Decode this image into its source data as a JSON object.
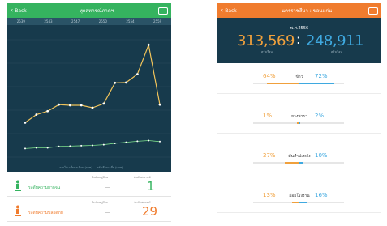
{
  "colors": {
    "green_nav": "#35b35f",
    "orange_nav": "#f07c2e",
    "dark_panel": "#173a4c",
    "orange_value": "#f0a03c",
    "blue_value": "#3fa9e0"
  },
  "left": {
    "nav": {
      "back_label": "Back",
      "title": "ทุกสหกรณ์ภาคฯ",
      "menu_icon": "menu-icon"
    },
    "years": [
      "2539",
      "2543",
      "2547",
      "2550",
      "2554",
      "2559"
    ],
    "legend": "— รายได้เฉลี่ยต่อเดือน (บาท) — ครัวเรือนเฉลี่ย (บาท)",
    "stats": {
      "rows": [
        {
          "name": "ระดับความยากจน",
          "col1_label": "อันดับหมู่บ้าน",
          "col2_label": "อันดับสหกรณ์",
          "col1_value": "—",
          "col2_value": "1",
          "color": "#35b35f"
        },
        {
          "name": "ระดับความปลอดภัย",
          "col1_label": "อันดับหมู่บ้าน",
          "col2_label": "อันดับสหกรณ์",
          "col1_value": "—",
          "col2_value": "29",
          "color": "#f07c2e"
        }
      ]
    }
  },
  "chart_data": {
    "type": "line",
    "x": [
      "2539",
      "2541",
      "2543",
      "2545",
      "2547",
      "2548",
      "2549",
      "2550",
      "2552",
      "2554",
      "2556",
      "2557",
      "2559"
    ],
    "series": [
      {
        "values": [
          100,
          123,
          133,
          152,
          150,
          150,
          143,
          155,
          215,
          216,
          240,
          325,
          152
        ]
      },
      {
        "values": [
          25,
          27,
          27,
          31,
          32,
          33,
          34,
          36,
          40,
          43,
          46,
          48,
          45
        ]
      }
    ]
  },
  "right": {
    "nav": {
      "back_label": "Back",
      "title": "นครราชสีมา : ขอนแก่น",
      "menu_icon": "menu-icon"
    },
    "year_label": "พ.ศ.2556",
    "left_value": "313,569",
    "colon": ":",
    "right_value": "248,911",
    "left_unit": "ครัวเรือน",
    "right_unit": "ครัวเรือน",
    "rows": [
      {
        "pct_left": "64%",
        "label": "ข้าว",
        "pct_right": "72%",
        "left_frac": 0.64,
        "right_frac": 0.72
      },
      {
        "pct_left": "1%",
        "label": "ยางพารา",
        "pct_right": "2%",
        "left_frac": 0.01,
        "right_frac": 0.02
      },
      {
        "pct_left": "27%",
        "label": "มันสำปะหลัง",
        "pct_right": "10%",
        "left_frac": 0.27,
        "right_frac": 0.1
      },
      {
        "pct_left": "13%",
        "label": "อ้อยโรงงาน",
        "pct_right": "16%",
        "left_frac": 0.13,
        "right_frac": 0.16
      }
    ]
  }
}
